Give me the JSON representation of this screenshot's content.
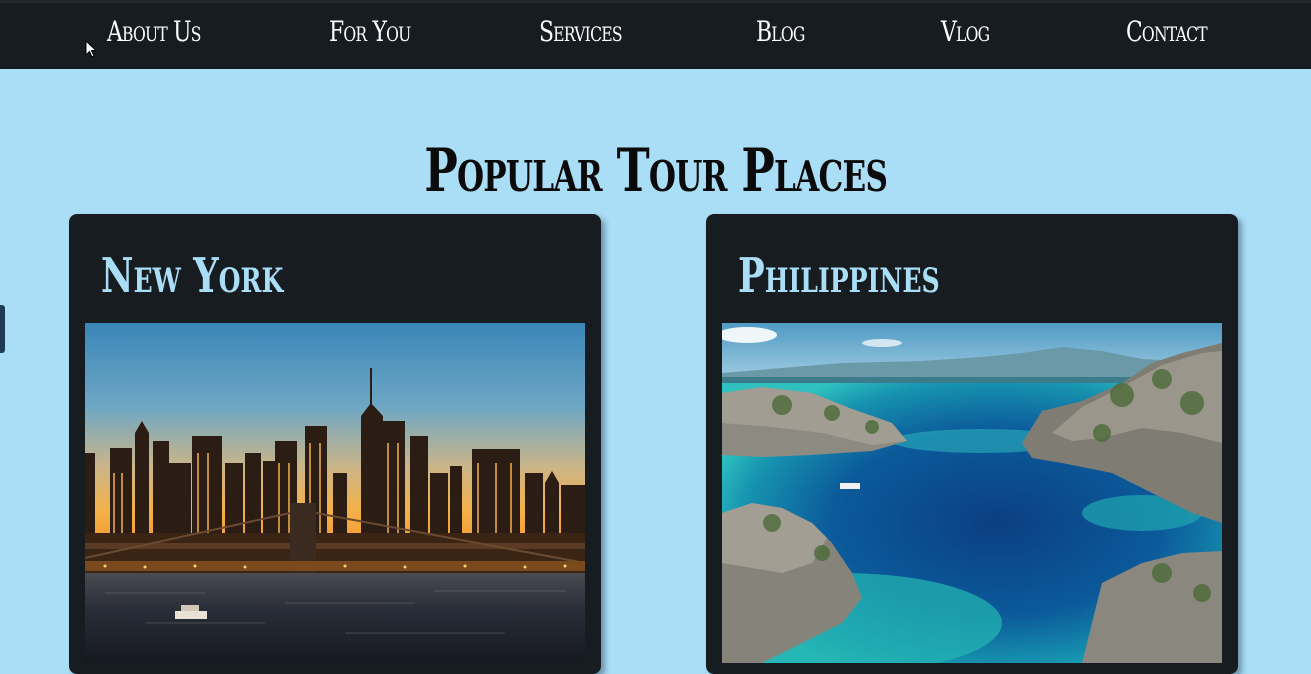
{
  "nav": {
    "items": [
      {
        "label": "About Us"
      },
      {
        "label": "For You"
      },
      {
        "label": "Services"
      },
      {
        "label": "Blog"
      },
      {
        "label": "Vlog"
      },
      {
        "label": "Contact"
      }
    ]
  },
  "main": {
    "title": "Popular Tour Places",
    "cards": [
      {
        "title": "New York",
        "image": "new-york-skyline-dusk"
      },
      {
        "title": "Philippines",
        "image": "philippines-lagoon-islands"
      }
    ]
  },
  "colors": {
    "background": "#a9def6",
    "navbar": "#171c21",
    "card": "#171c21",
    "card_title": "#a9def6"
  }
}
